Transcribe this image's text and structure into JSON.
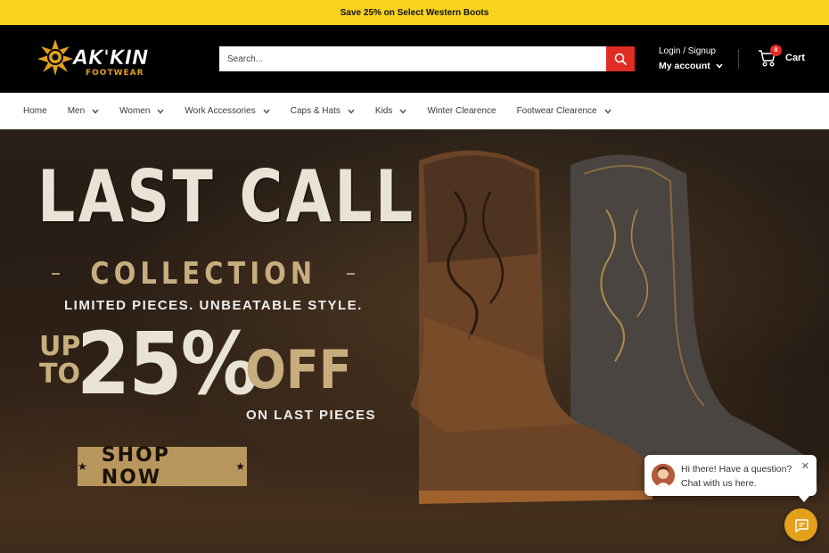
{
  "announcement": {
    "text": "Save 25% on Select Western Boots"
  },
  "logo": {
    "text": "AK'KIN",
    "sub": "FOOTWEAR"
  },
  "search": {
    "placeholder": "Search..."
  },
  "account": {
    "login": "Login / Signup",
    "my_account": "My account"
  },
  "cart": {
    "count": "0",
    "label": "Cart"
  },
  "nav": {
    "items": [
      {
        "label": "Home",
        "dropdown": false
      },
      {
        "label": "Men",
        "dropdown": true
      },
      {
        "label": "Women",
        "dropdown": true
      },
      {
        "label": "Work Accessories",
        "dropdown": true
      },
      {
        "label": "Caps & Hats",
        "dropdown": true
      },
      {
        "label": "Kids",
        "dropdown": true
      },
      {
        "label": "Winter Clearence",
        "dropdown": false
      },
      {
        "label": "Footwear Clearence",
        "dropdown": true
      }
    ]
  },
  "hero": {
    "title": "LAST CALL",
    "collection": "COLLECTION",
    "subtitle": "LIMITED PIECES. UNBEATABLE STYLE.",
    "up": "UP",
    "to": "TO",
    "percent": "25%",
    "off": "OFF",
    "on_last": "ON LAST PIECES",
    "cta": "SHOP NOW"
  },
  "chat": {
    "line1": "Hi there! Have a question?",
    "line2": "Chat with us here."
  },
  "colors": {
    "accent_yellow": "#f7d21e",
    "search_red": "#e12c24",
    "gold": "#c8ad7f",
    "chat_orange": "#e3a01b"
  }
}
